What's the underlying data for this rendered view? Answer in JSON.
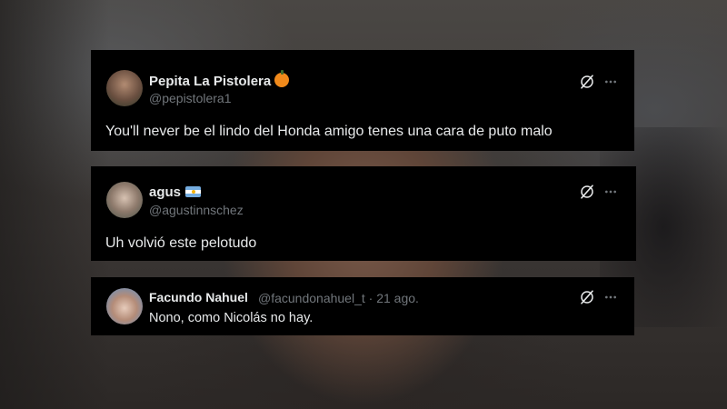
{
  "tweets": [
    {
      "display_name": "Pepita La Pistolera",
      "display_emoji": "pumpkin-emoji",
      "handle": "@pepistolera1",
      "text": "You'll never be el lindo del Honda amigo tenes una cara de puto malo"
    },
    {
      "display_name": "agus",
      "display_emoji": "argentina-flag-emoji",
      "handle": "@agustinnschez",
      "text": "Uh volvió este pelotudo"
    },
    {
      "display_name": "Facundo Nahuel",
      "handle_and_date": "@facundonahuel_t · 21 ago.",
      "text": "Nono, como Nicolás no hay."
    }
  ],
  "icons": {
    "grok": "grok-icon",
    "more": "more-options-icon"
  },
  "colors": {
    "card_background": "#000000",
    "primary_text": "#e7e9ea",
    "secondary_text": "#71767b"
  }
}
